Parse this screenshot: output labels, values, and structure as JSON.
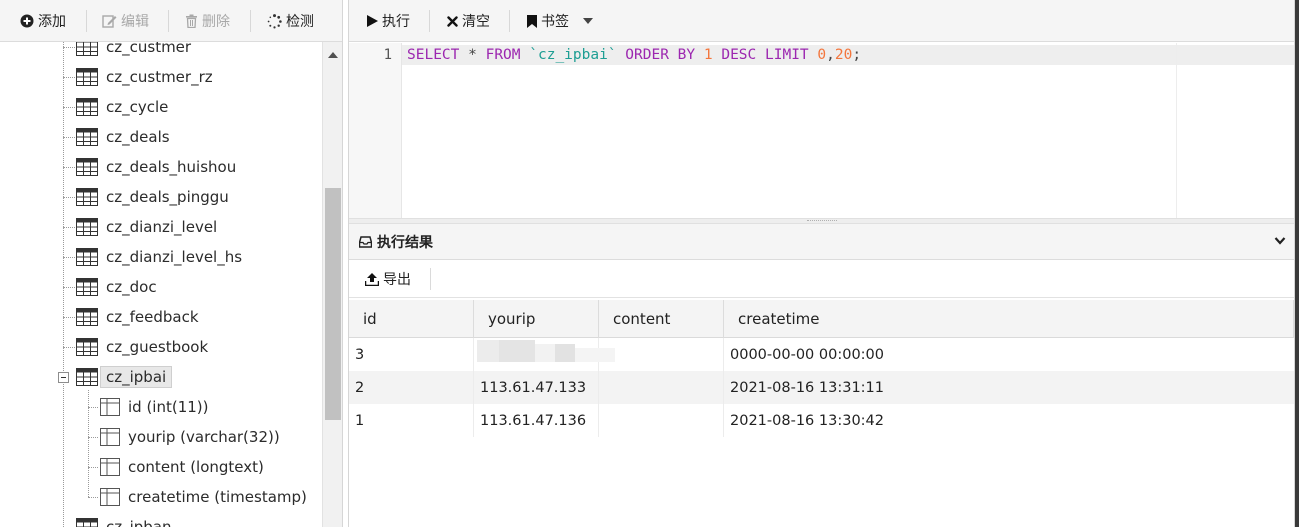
{
  "left_toolbar": {
    "add_label": "添加",
    "edit_label": "编辑",
    "delete_label": "删除",
    "check_label": "检测"
  },
  "tree": {
    "tables": [
      "cz_custmer",
      "cz_custmer_rz",
      "cz_cycle",
      "cz_deals",
      "cz_deals_huishou",
      "cz_deals_pinggu",
      "cz_dianzi_level",
      "cz_dianzi_level_hs",
      "cz_doc",
      "cz_feedback",
      "cz_guestbook",
      "cz_ipbai",
      "cz_ipban"
    ],
    "selected_table": "cz_ipbai",
    "columns": [
      "id (int(11))",
      "yourip (varchar(32))",
      "content (longtext)",
      "createtime (timestamp)"
    ]
  },
  "right_toolbar": {
    "run_label": "执行",
    "clear_label": "清空",
    "bookmark_label": "书签"
  },
  "editor": {
    "line_number": "1",
    "tokens": {
      "select": "SELECT",
      "star": "*",
      "from": "FROM",
      "table": "`cz_ipbai`",
      "order_by": "ORDER BY",
      "one": "1",
      "desc": "DESC",
      "limit": "LIMIT",
      "offset": "0",
      "comma": ",",
      "count": "20",
      "semicolon": ";"
    }
  },
  "results": {
    "title": "执行结果",
    "export_label": "导出",
    "columns": [
      "id",
      "yourip",
      "content",
      "createtime"
    ],
    "rows": [
      {
        "id": "3",
        "yourip": "",
        "content": "",
        "createtime": "0000-00-00 00:00:00"
      },
      {
        "id": "2",
        "yourip": "113.61.47.133",
        "content": "",
        "createtime": "2021-08-16 13:31:11"
      },
      {
        "id": "1",
        "yourip": "113.61.47.136",
        "content": "",
        "createtime": "2021-08-16 13:30:42"
      }
    ]
  },
  "colors": {
    "keyword": "#9c27b0",
    "backtick_identifier": "#1e9e94",
    "number": "#f3763d"
  }
}
